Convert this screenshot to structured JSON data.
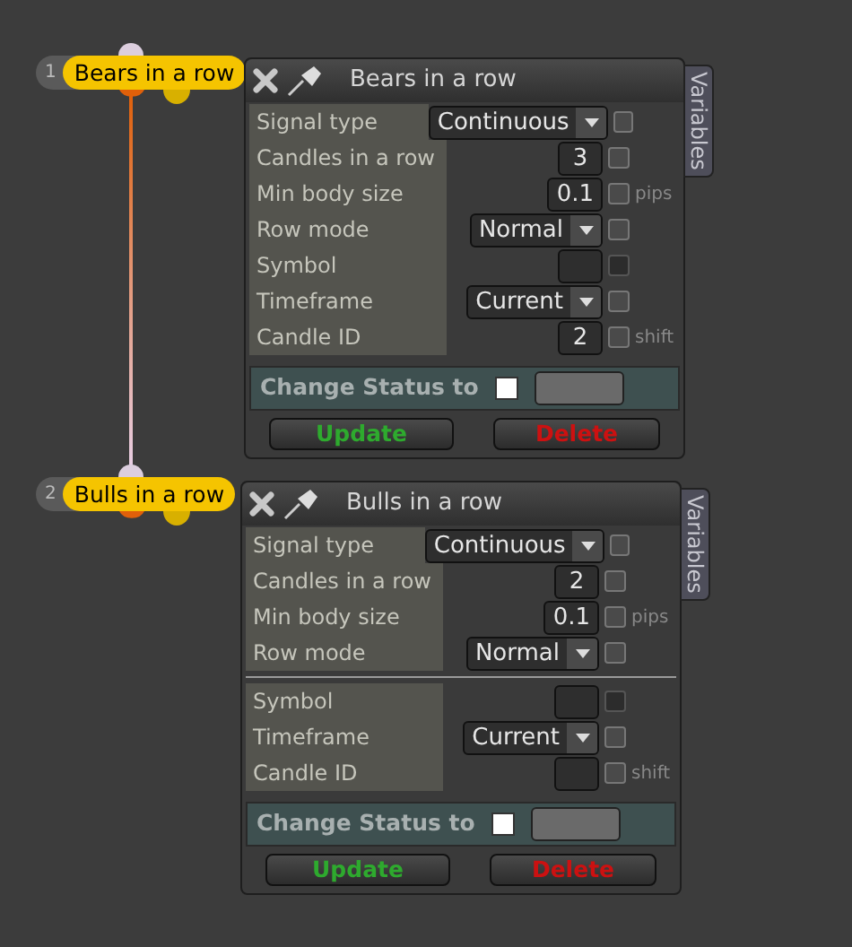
{
  "nodes": [
    {
      "number": "1",
      "label": "Bears in a row",
      "panel": {
        "title": "Bears in a row",
        "tab": "Variables",
        "groups": [
          [
            {
              "label": "Signal type",
              "kind": "dropdown",
              "value": "Continuous",
              "checked": false,
              "disabled": false
            },
            {
              "label": "Candles in a row",
              "kind": "number",
              "value": "3",
              "checked": false,
              "disabled": false
            },
            {
              "label": "Min body size",
              "kind": "number",
              "value": "0.1",
              "checked": false,
              "disabled": false,
              "suffix": "pips"
            },
            {
              "label": "Row mode",
              "kind": "dropdown",
              "value": "Normal",
              "checked": false,
              "disabled": false
            },
            {
              "label": "Symbol",
              "kind": "number",
              "checked": false,
              "disabled": true
            },
            {
              "label": "Timeframe",
              "kind": "dropdown",
              "value": "Current",
              "checked": false,
              "disabled": false
            },
            {
              "label": "Candle ID",
              "kind": "number",
              "value": "2",
              "checked": false,
              "disabled": false,
              "suffix": "shift"
            }
          ]
        ],
        "status": {
          "label": "Change Status to",
          "checked": false
        },
        "buttons": [
          {
            "label": "Update",
            "kind": "update"
          },
          {
            "label": "Delete",
            "kind": "delete"
          }
        ]
      }
    },
    {
      "number": "2",
      "label": "Bulls in a row",
      "panel": {
        "title": "Bulls in a row",
        "tab": "Variables",
        "groups": [
          [
            {
              "label": "Signal type",
              "kind": "dropdown",
              "value": "Continuous",
              "checked": false,
              "disabled": false
            },
            {
              "label": "Candles in a row",
              "kind": "number",
              "value": "2",
              "checked": false,
              "disabled": false
            },
            {
              "label": "Min body size",
              "kind": "number",
              "value": "0.1",
              "checked": false,
              "disabled": false,
              "suffix": "pips"
            },
            {
              "label": "Row mode",
              "kind": "dropdown",
              "value": "Normal",
              "checked": false,
              "disabled": false
            }
          ],
          [
            {
              "label": "Symbol",
              "kind": "number",
              "checked": false,
              "disabled": true
            },
            {
              "label": "Timeframe",
              "kind": "dropdown",
              "value": "Current",
              "checked": false,
              "disabled": false
            },
            {
              "label": "Candle ID",
              "kind": "number",
              "checked": false,
              "disabled": false,
              "suffix": "shift"
            }
          ]
        ],
        "status": {
          "label": "Change Status to",
          "checked": false
        },
        "buttons": [
          {
            "label": "Update",
            "kind": "update"
          },
          {
            "label": "Delete",
            "kind": "delete"
          }
        ]
      }
    }
  ]
}
